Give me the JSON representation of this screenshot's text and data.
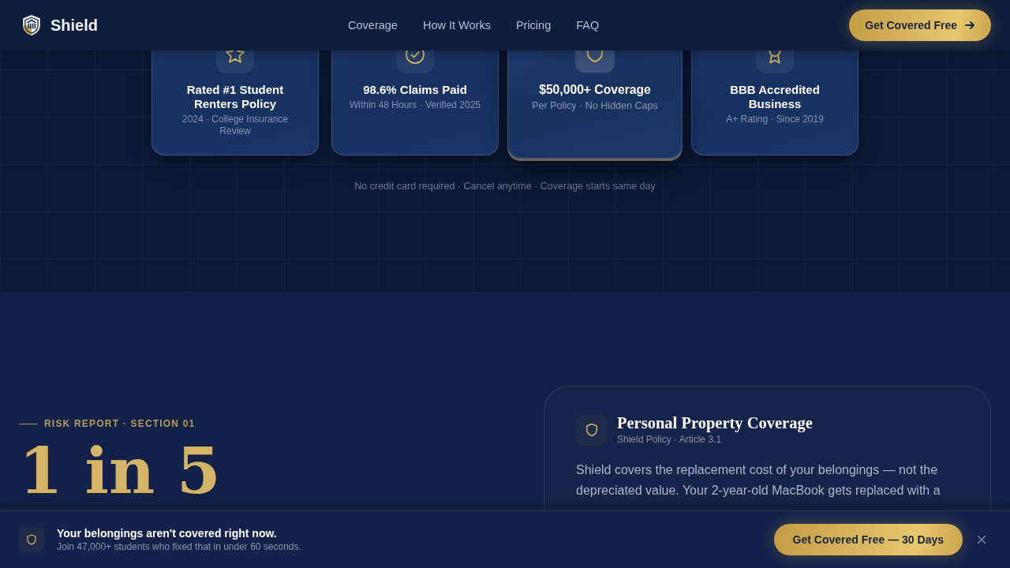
{
  "header": {
    "brand": "Shield",
    "nav": [
      {
        "label": "Coverage"
      },
      {
        "label": "How It Works"
      },
      {
        "label": "Pricing"
      },
      {
        "label": "FAQ"
      }
    ],
    "cta": "Get Covered Free"
  },
  "hero": {
    "badges": [
      {
        "title": "Rated #1 Student Renters Policy",
        "subtitle": "2024 · College Insurance Review",
        "highlighted": false
      },
      {
        "title": "98.6% Claims Paid",
        "subtitle": "Within 48 Hours · Verified 2025",
        "highlighted": false
      },
      {
        "title": "$50,000+ Coverage",
        "subtitle": "Per Policy · No Hidden Caps",
        "highlighted": true
      },
      {
        "title": "BBB Accredited Business",
        "subtitle": "A+ Rating · Since 2019",
        "highlighted": false
      }
    ],
    "note": "No credit card required · Cancel anytime · Coverage starts same day"
  },
  "risk_report": {
    "eyebrow": "RISK REPORT · SECTION 01",
    "stat": "1 in 5"
  },
  "policy_card": {
    "title": "Personal Property Coverage",
    "subtitle": "Shield Policy · Article 3.1",
    "body": "Shield covers the replacement cost of your belongings — not the depreciated value. Your 2-year-old MacBook gets replaced with a"
  },
  "sticky_bar": {
    "title": "Your belongings aren't covered right now.",
    "subtitle": "Join 47,000+ students who fixed that in under 60 seconds.",
    "cta": "Get Covered Free — 30 Days"
  }
}
